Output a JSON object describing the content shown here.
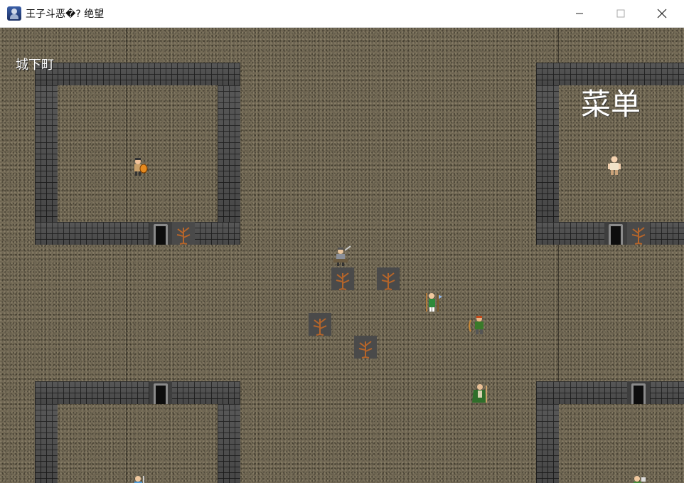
{
  "window": {
    "title": "王子斗恶�? 绝望",
    "icon": "knight-app-icon",
    "controls": [
      "minimize-icon",
      "maximize-icon",
      "close-icon"
    ]
  },
  "game": {
    "area_name": "城下町",
    "menu_label": "菜单",
    "colors": {
      "ground": "#6e6552",
      "wall": "#4d4d4d",
      "tree_trunk": "#b5652a",
      "label_text": "#ffffff"
    },
    "characters": [
      "warrior-with-shield",
      "bald-villager",
      "armored-soldier",
      "green-mage-with-axe",
      "green-archer",
      "green-cloaked-guard",
      "villager-bottom-left",
      "villager-bottom-right"
    ],
    "objects": [
      "dead-tree",
      "dungeon-door"
    ]
  }
}
